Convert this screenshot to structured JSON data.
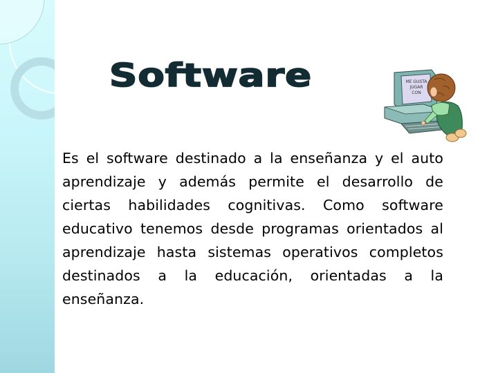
{
  "slide": {
    "title": "Software",
    "body": "Es el software destinado a la enseñanza y el auto aprendizaje y además permite el desarrollo de ciertas habilidades cognitivas. Como software educativo tenemos desde programas orientados al aprendizaje hasta sistemas operativos completos destinados a la educación, orientadas a la enseñanza.",
    "clipart": {
      "description": "child-at-computer",
      "screen_text": [
        "ME GUSTA",
        "JUGAR",
        "CON"
      ]
    }
  },
  "theme": {
    "strip_color_top": "#d8fbfd",
    "strip_color_bottom": "#9fd7e1",
    "title_color": "#132c33",
    "text_color": "#000000"
  }
}
